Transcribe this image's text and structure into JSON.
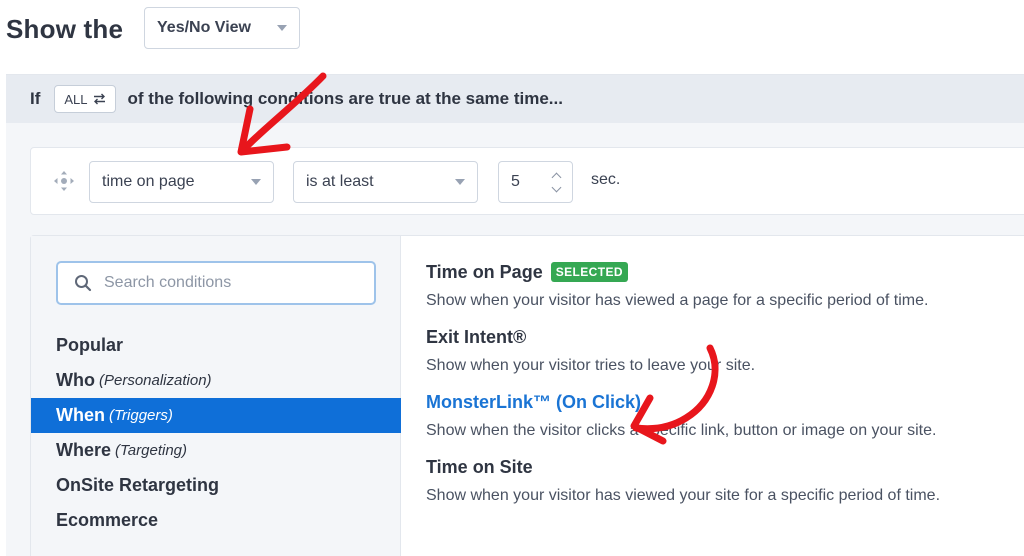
{
  "header": {
    "title": "Show the",
    "view_select": "Yes/No View"
  },
  "if_bar": {
    "if_label": "If",
    "match_button": "ALL",
    "match_icon": "swap-arrows-icon",
    "rest_text": "of the following conditions are true at the same time..."
  },
  "condition": {
    "field": "time on page",
    "operator": "is at least",
    "value": "5",
    "unit": "sec."
  },
  "search": {
    "placeholder": "Search conditions"
  },
  "categories": [
    {
      "label": "Popular",
      "sub": ""
    },
    {
      "label": "Who",
      "sub": "(Personalization)"
    },
    {
      "label": "When",
      "sub": "(Triggers)"
    },
    {
      "label": "Where",
      "sub": "(Targeting)"
    },
    {
      "label": "OnSite Retargeting",
      "sub": ""
    },
    {
      "label": "Ecommerce",
      "sub": ""
    }
  ],
  "items": [
    {
      "title": "Time on Page",
      "badge": "SELECTED",
      "desc": "Show when your visitor has viewed a page for a specific period of time."
    },
    {
      "title": "Exit Intent®",
      "desc": "Show when your visitor tries to leave your site."
    },
    {
      "title": "MonsterLink™ (On Click)",
      "desc": "Show when the visitor clicks a specific link, button or image on your site."
    },
    {
      "title": "Time on Site",
      "desc": "Show when your visitor has viewed your site for a specific period of time."
    }
  ],
  "colors": {
    "accent": "#0f6fd8",
    "link": "#1a74d4",
    "selected_badge": "#35a853",
    "annotation": "#e8161c"
  }
}
